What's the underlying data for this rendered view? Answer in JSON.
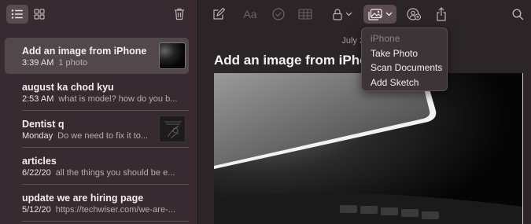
{
  "sidebar": {
    "notes": [
      {
        "title": "Add an image from iPhone",
        "date": "3:39 AM",
        "preview": "1 photo",
        "thumb": "photo-thumbnail"
      },
      {
        "title": "august ka chod kyu",
        "date": "2:53 AM",
        "preview": "what is model? how do you b..."
      },
      {
        "title": "Dentist q",
        "date": "Monday",
        "preview": "Do we need to fix it to...",
        "thumb": "sketch-thumbnail"
      },
      {
        "title": "articles",
        "date": "6/22/20",
        "preview": "all the things you should be e..."
      },
      {
        "title": "update we are hiring page",
        "date": "5/12/20",
        "preview": "https://techwiser.com/we-are-..."
      }
    ]
  },
  "editor": {
    "date": "July 2, 2020",
    "heading": "Add an image from iPhone"
  },
  "menu": {
    "header": "iPhone",
    "items": [
      "Take Photo",
      "Scan Documents",
      "Add Sketch"
    ]
  },
  "colors": {
    "sidebar_bg": "#372a30",
    "main_bg": "#2b2527",
    "selected_row": "#52484c"
  }
}
